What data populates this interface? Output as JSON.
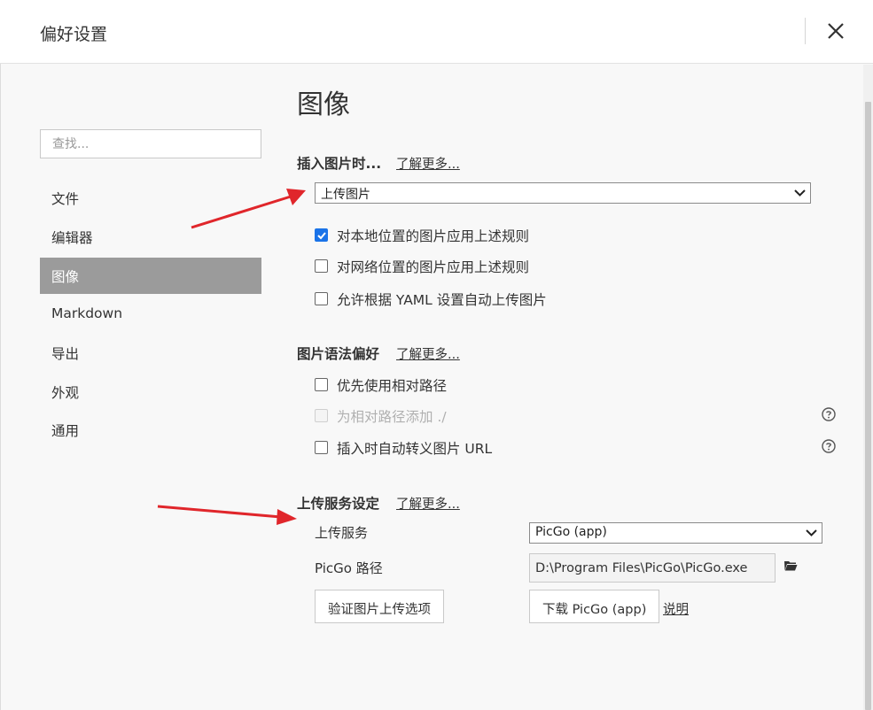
{
  "window": {
    "title": "偏好设置",
    "close_icon": "close-icon"
  },
  "sidebar": {
    "search_placeholder": "查找...",
    "items": [
      {
        "label": "文件"
      },
      {
        "label": "编辑器"
      },
      {
        "label": "图像",
        "active": true
      },
      {
        "label": "Markdown"
      },
      {
        "label": "导出"
      },
      {
        "label": "外观"
      },
      {
        "label": "通用"
      }
    ]
  },
  "main": {
    "heading": "图像",
    "insert": {
      "title": "插入图片时...",
      "learn_more": "了解更多...",
      "select_value": "上传图片",
      "options": [
        {
          "label": "对本地位置的图片应用上述规则",
          "checked": true,
          "disabled": false
        },
        {
          "label": "对网络位置的图片应用上述规则",
          "checked": false,
          "disabled": false
        },
        {
          "label": "允许根据 YAML 设置自动上传图片",
          "checked": false,
          "disabled": false
        }
      ]
    },
    "syntax": {
      "title": "图片语法偏好",
      "learn_more": "了解更多...",
      "options": [
        {
          "label": "优先使用相对路径",
          "checked": false,
          "disabled": false
        },
        {
          "label": "为相对路径添加 ./",
          "checked": false,
          "disabled": true
        },
        {
          "label": "插入时自动转义图片 URL",
          "checked": false,
          "disabled": false
        }
      ]
    },
    "upload": {
      "title": "上传服务设定",
      "learn_more": "了解更多...",
      "service_label": "上传服务",
      "service_value": "PicGo (app)",
      "path_label": "PicGo 路径",
      "path_value": "D:\\Program Files\\PicGo\\PicGo.exe",
      "verify_button": "验证图片上传选项",
      "download_button": "下载 PicGo (app)",
      "explain_link": "说明"
    }
  },
  "colors": {
    "accent": "#1a73e8",
    "active_nav": "#9b9b9b",
    "annotation_arrow": "#e0262b"
  }
}
